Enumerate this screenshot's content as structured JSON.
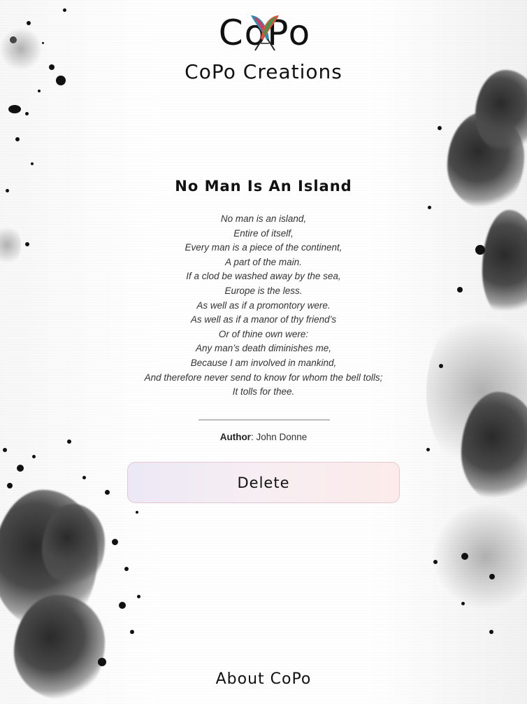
{
  "header": {
    "logo_text": "CoPo",
    "site_title": "CoPo Creations"
  },
  "poem": {
    "title": "No Man Is An Island",
    "lines": [
      "No man is an island,",
      "Entire of itself,",
      "Every man is a piece of the continent,",
      "A part of the main.",
      "If a clod be washed away by the sea,",
      "Europe is the less.",
      "As well as if a promontory were.",
      "As well as if a manor of thy friend’s",
      "Or of thine own were:",
      "Any man’s death diminishes me,",
      "Because I am involved in mankind,",
      "And therefore never send to know for whom the bell tolls;",
      "It tolls for thee."
    ],
    "author_label": "Author",
    "author_separator": ": ",
    "author_name": "John Donne"
  },
  "actions": {
    "delete_label": "Delete"
  },
  "footer": {
    "about_label": "About CoPo"
  },
  "colors": {
    "button_border": "#e4c7d3",
    "button_gradient_start": "#ece8f5",
    "button_gradient_end": "#fcebea",
    "ink": "#111111"
  },
  "icons": {
    "logo_quills": "crossed-feather-quills-icon"
  }
}
